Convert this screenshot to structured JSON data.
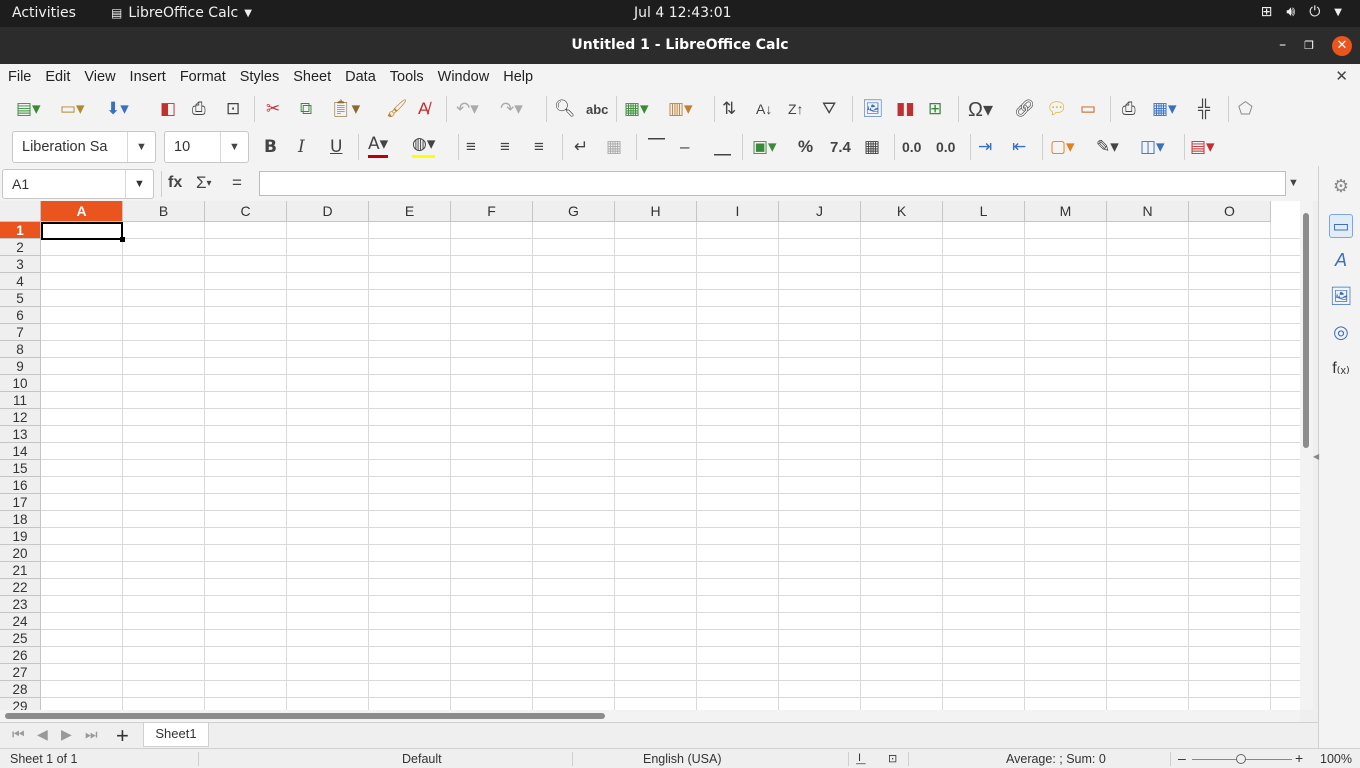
{
  "topbar": {
    "activities": "Activities",
    "app_name": "LibreOffice Calc",
    "clock": "Jul 4  12:43:01"
  },
  "window": {
    "title": "Untitled 1 - LibreOffice Calc"
  },
  "menu": [
    "File",
    "Edit",
    "View",
    "Insert",
    "Format",
    "Styles",
    "Sheet",
    "Data",
    "Tools",
    "Window",
    "Help"
  ],
  "toolbar2": {
    "font_name": "Liberation Sa",
    "font_size": "10"
  },
  "formula_bar": {
    "name_box": "A1",
    "input_value": "",
    "sum_symbol": "Σ",
    "equals_symbol": "="
  },
  "columns": [
    "A",
    "B",
    "C",
    "D",
    "E",
    "F",
    "G",
    "H",
    "I",
    "J",
    "K",
    "L",
    "M",
    "N",
    "O"
  ],
  "rows": [
    "1",
    "2",
    "3",
    "4",
    "5",
    "6",
    "7",
    "8",
    "9",
    "10",
    "11",
    "12",
    "13",
    "14",
    "15",
    "16",
    "17",
    "18",
    "19",
    "20",
    "21",
    "22",
    "23",
    "24",
    "25",
    "26",
    "27",
    "28",
    "29"
  ],
  "selected_cell": "A1",
  "sheets": [
    "Sheet1"
  ],
  "status": {
    "sheet_info": "Sheet 1 of 1",
    "page_style": "Default",
    "language": "English (USA)",
    "summary": "Average: ; Sum: 0",
    "zoom": "100%"
  },
  "colors": {
    "accent": "#e9541f",
    "topbar": "#1d1d1d",
    "titlebar": "#2c2c2c"
  }
}
